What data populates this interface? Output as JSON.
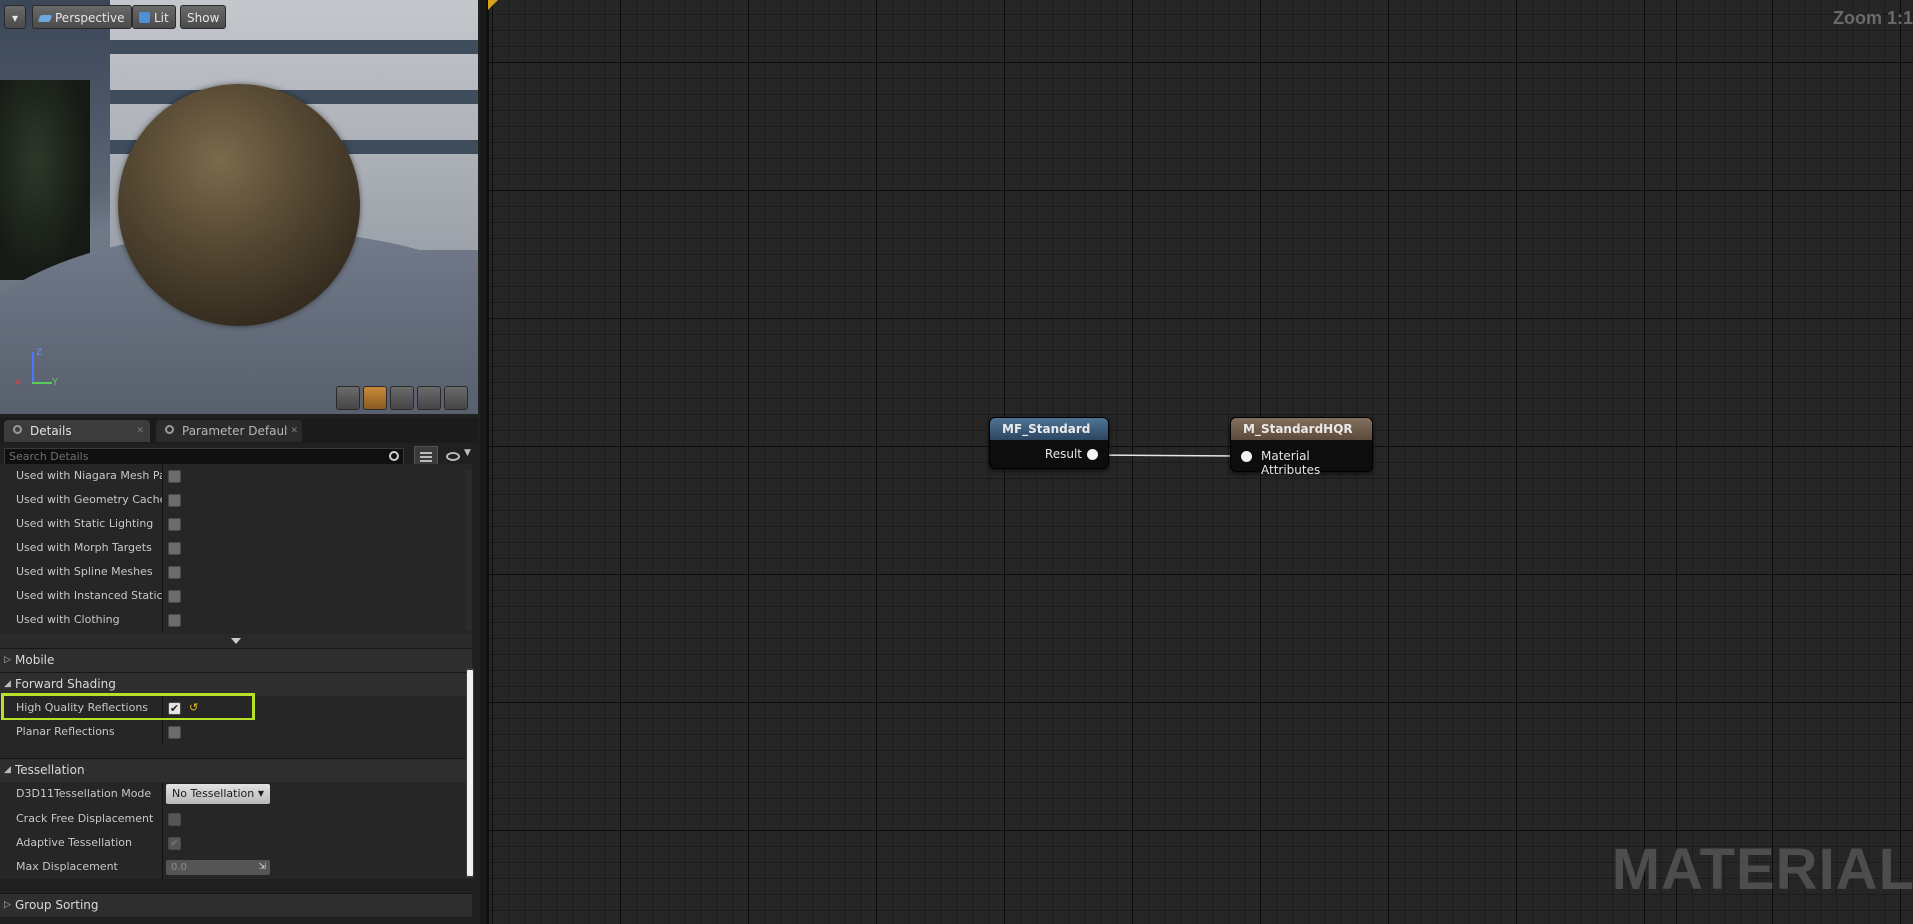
{
  "viewport": {
    "toolbar": {
      "dropdown_label": "▾",
      "perspective_label": "Perspective",
      "lit_label": "Lit",
      "show_label": "Show"
    },
    "axis": {
      "x": "✕",
      "y": "Y",
      "z": "Z"
    }
  },
  "tabs": [
    {
      "label": "Details",
      "close": "✕"
    },
    {
      "label": "Parameter Defaults",
      "close": "✕"
    }
  ],
  "search": {
    "placeholder": "Search Details"
  },
  "usage_rows": [
    {
      "label": "Used with Niagara Mesh Particles",
      "checked": false
    },
    {
      "label": "Used with Geometry Cache",
      "checked": false
    },
    {
      "label": "Used with Static Lighting",
      "checked": false
    },
    {
      "label": "Used with Morph Targets",
      "checked": false
    },
    {
      "label": "Used with Spline Meshes",
      "checked": false
    },
    {
      "label": "Used with Instanced Static Meshes",
      "checked": false
    },
    {
      "label": "Used with Clothing",
      "checked": false
    }
  ],
  "categories": {
    "mobile": "Mobile",
    "forward_shading": "Forward Shading",
    "tessellation": "Tessellation",
    "group_sorting": "Group Sorting"
  },
  "forward_shading": {
    "high_quality_reflections": {
      "label": "High Quality Reflections",
      "checked": true,
      "reset": "↺"
    },
    "planar_reflections": {
      "label": "Planar Reflections",
      "checked": false
    }
  },
  "tessellation": {
    "mode_label": "D3D11Tessellation Mode",
    "mode_value": "No Tessellation",
    "crack_free_label": "Crack Free Displacement",
    "adaptive_label": "Adaptive Tessellation",
    "max_disp_label": "Max Displacement",
    "max_disp_value": "0.0"
  },
  "graph": {
    "zoom": "Zoom 1:1",
    "watermark": "MATERIAL",
    "nodes": {
      "mf_standard": {
        "title": "MF_Standard",
        "pin": "Result",
        "header_color": "#3d5a7a"
      },
      "m_standard_hqr": {
        "title": "M_StandardHQR",
        "pin": "Material Attributes",
        "header_color": "#6e5a4a"
      }
    },
    "highlight_color": "#b6e02a"
  }
}
